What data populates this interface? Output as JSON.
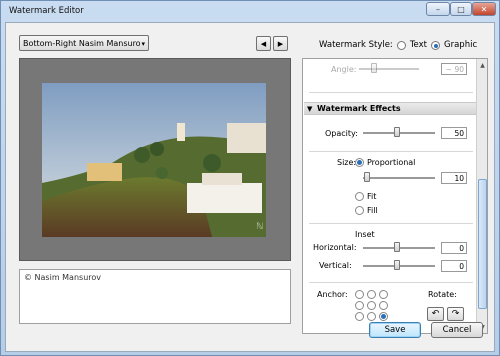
{
  "window": {
    "title": "Watermark Editor"
  },
  "title_buttons": {
    "minimize": "–",
    "maximize": "□",
    "close": "✕"
  },
  "preset": {
    "selected": "Bottom-Right Nasim Mansuro",
    "caret": "▾"
  },
  "nav": {
    "prev": "◀",
    "next": "▶"
  },
  "watermark_style": {
    "label": "Watermark Style:",
    "options": [
      "Text",
      "Graphic"
    ],
    "selected": "Graphic"
  },
  "copyright_text": "© Nasim Mansurov",
  "panel": {
    "angle": {
      "label": "Angle:",
      "value": "~ 90"
    },
    "effects_header": "Watermark Effects",
    "opacity": {
      "label": "Opacity:",
      "value": "50",
      "level": 0.5
    },
    "size": {
      "label": "Size:",
      "options": [
        "Proportional",
        "Fit",
        "Fill"
      ],
      "selected": "Proportional",
      "value": "10",
      "level": 0.05
    },
    "inset": {
      "label": "Inset",
      "horizontal": {
        "label": "Horizontal:",
        "value": "0",
        "level": 0.5
      },
      "vertical": {
        "label": "Vertical:",
        "value": "0",
        "level": 0.5
      }
    },
    "anchor": {
      "label": "Anchor:",
      "selected_index": 8
    },
    "rotate": {
      "label": "Rotate:",
      "left_icon": "↶",
      "right_icon": "↷"
    }
  },
  "scrollbar": {
    "up": "▲",
    "down": "▼"
  },
  "buttons": {
    "save": "Save",
    "cancel": "Cancel"
  },
  "colors": {
    "title_bar": "#c9dcf1",
    "accent": "#2a6fb9",
    "preview_bg": "#777777",
    "close_button": "#c2452d"
  }
}
